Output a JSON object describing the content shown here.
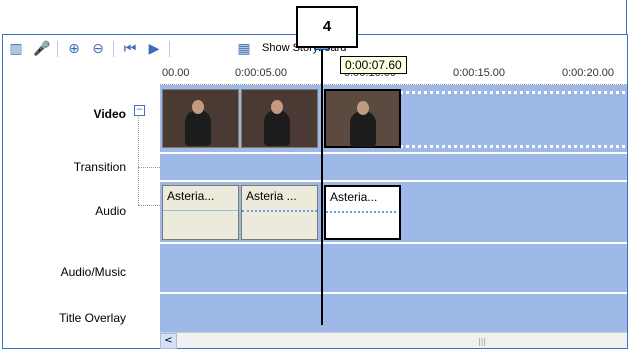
{
  "toolbar": {
    "show_storyboard_label": "Show Storyboard"
  },
  "annotation": {
    "badge_number": "4"
  },
  "ruler": {
    "ticks": [
      "00.00",
      "0:00:05.00",
      "0:00:10.00",
      "0:00:15.00",
      "0:00:20.00"
    ]
  },
  "tracks": {
    "video": "Video",
    "transition": "Transition",
    "audio": "Audio",
    "audio_music": "Audio/Music",
    "title_overlay": "Title Overlay"
  },
  "audio_clips": [
    "Asteria...",
    "Asteria ...",
    "Asteria..."
  ],
  "playhead_tooltip": "0:00:07.60",
  "colors": {
    "track_bg": "#9eb8e8",
    "frame_border": "#3d73c9",
    "tooltip_bg": "#ffffe1"
  }
}
